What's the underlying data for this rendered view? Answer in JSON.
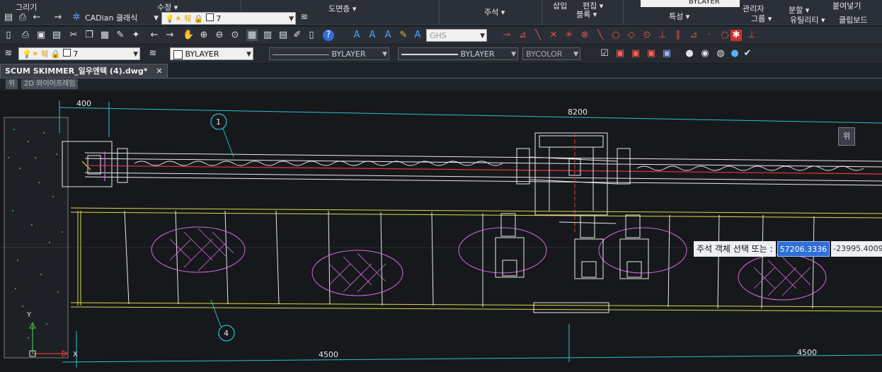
{
  "ribbon": {
    "panels": [
      {
        "label": "그리기",
        "group": ""
      },
      {
        "label": "수정 ▾",
        "group": ""
      },
      {
        "label": "도면층 ▾",
        "group": ""
      },
      {
        "label": "주석 ▾",
        "group": ""
      },
      {
        "label": "삽입",
        "group": ""
      },
      {
        "label": "편집 ▾",
        "group": "블록 ▾"
      },
      {
        "label": "BYLAYER",
        "group": "특성 ▾"
      },
      {
        "label": "관리자",
        "group": "그룹 ▾"
      },
      {
        "label": "분할 ▾",
        "group": "유틸리티 ▾"
      },
      {
        "label": "붙여넣기",
        "group": "클립보드"
      }
    ]
  },
  "toolbar1": {
    "workspace": "CADian 클래식",
    "layer_name": "7"
  },
  "toolbar2": {
    "text_style": "GHS"
  },
  "toolbar3": {
    "layer_name": "7",
    "color": "BYLAYER",
    "linetype": "BYLAYER",
    "lineweight": "BYLAYER",
    "plotstyle": "BYCOLOR"
  },
  "document": {
    "tab_label": "SCUM SKIMMER_일우엔텍 (4).dwg*",
    "close": "✕"
  },
  "viewport": {
    "label_view": "위",
    "label_style": "2D 와이어프레임",
    "nav_button": "위"
  },
  "drawing": {
    "dim_top_left": "400",
    "dim_top_main": "8200",
    "dim_bottom_left": "4500",
    "dim_bottom_right": "4500",
    "balloon_1": "1",
    "balloon_4": "4",
    "ucs_y": "Y",
    "ucs_x": "X"
  },
  "command": {
    "prompt": "주석 객체 선택 또는 :",
    "x_value": "57206.3336",
    "y_value": "-23995.4009"
  },
  "colors": {
    "cad_bg": "#16181c",
    "dim": "#29c3c8",
    "geom": "#e8e8e8",
    "hatch": "#d46ad8",
    "yellow": "#d8d84a",
    "center": "#e03a3a"
  }
}
